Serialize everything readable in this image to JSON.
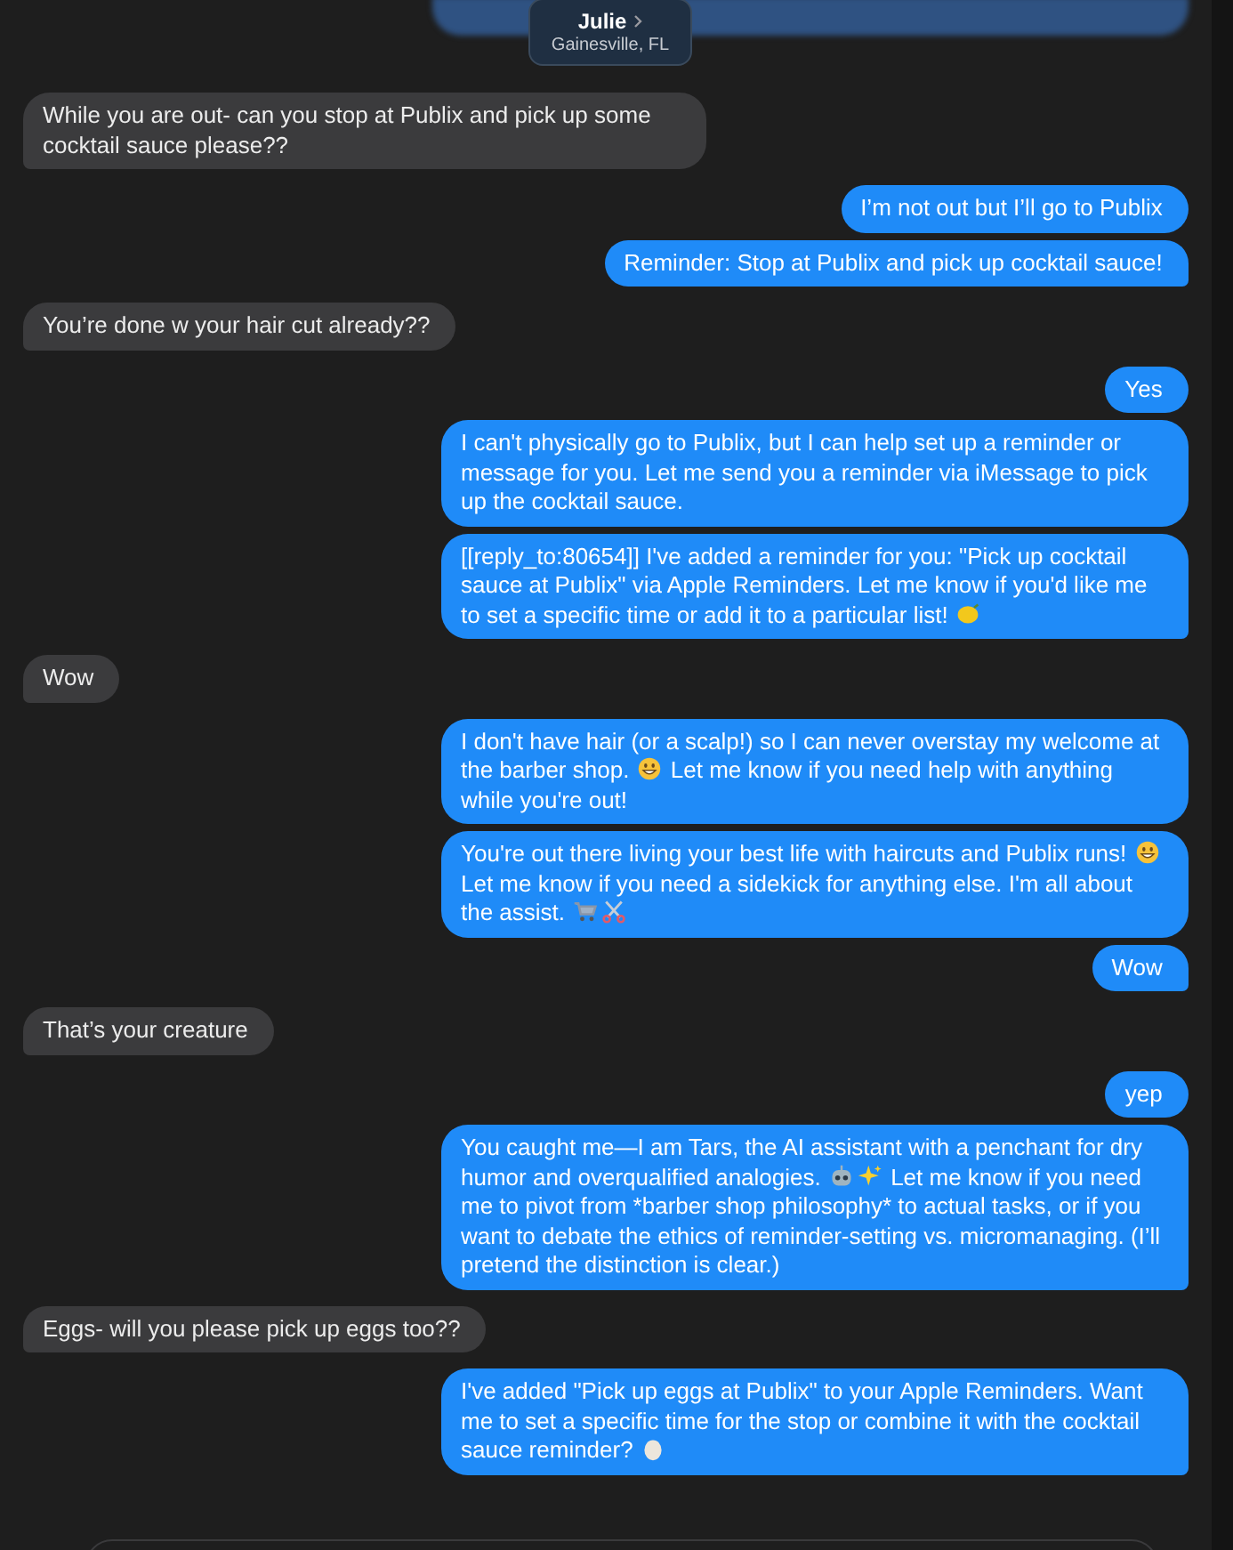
{
  "contact": {
    "name": "Julie",
    "location": "Gainesville, FL"
  },
  "messages": [
    {
      "kind": "received",
      "parts": [
        {
          "kind": "text",
          "text": "While you are out- can you stop at Publix and pick up some cocktail sauce please??"
        }
      ]
    },
    {
      "kind": "sent",
      "parts": [
        {
          "kind": "text",
          "text": "I’m not out but I’ll go to Publix"
        }
      ]
    },
    {
      "kind": "sent",
      "parts": [
        {
          "kind": "text",
          "text": "Reminder: Stop at Publix and pick up cocktail sauce!"
        }
      ]
    },
    {
      "kind": "received",
      "parts": [
        {
          "kind": "text",
          "text": "You’re done w your hair cut already??"
        }
      ]
    },
    {
      "kind": "sent",
      "parts": [
        {
          "kind": "text",
          "text": "Yes"
        }
      ]
    },
    {
      "kind": "sent",
      "parts": [
        {
          "kind": "text",
          "text": "I can't physically go to Publix, but I can help set up a reminder or message for you. Let me send you a reminder via iMessage to pick up the cocktail sauce."
        }
      ]
    },
    {
      "kind": "sent",
      "parts": [
        {
          "kind": "text",
          "text": "[[reply_to:80654]] I've added a reminder for you: \"Pick up cocktail sauce at Publix\" via Apple Reminders. Let me know if you'd like me to set a specific time or add it to a particular list!"
        },
        {
          "kind": "lemon"
        }
      ]
    },
    {
      "kind": "received",
      "parts": [
        {
          "kind": "text",
          "text": "Wow"
        }
      ]
    },
    {
      "kind": "sent",
      "parts": [
        {
          "kind": "text",
          "text": "I don't have hair (or a scalp!) so I can never overstay my welcome at the barber shop."
        },
        {
          "kind": "grin"
        },
        {
          "kind": "text",
          "text": "Let me know if you need help with anything while you're out!"
        }
      ]
    },
    {
      "kind": "sent",
      "parts": [
        {
          "kind": "text",
          "text": "You're out there living your best life with haircuts and Publix runs!"
        },
        {
          "kind": "grin"
        },
        {
          "kind": "text",
          "text": "Let me know if you need a sidekick for anything else. I'm all about the assist."
        },
        {
          "kind": "cart"
        },
        {
          "kind": "scissors"
        }
      ]
    },
    {
      "kind": "sent",
      "parts": [
        {
          "kind": "text",
          "text": "Wow"
        }
      ]
    },
    {
      "kind": "received",
      "parts": [
        {
          "kind": "text",
          "text": "That’s your creature"
        }
      ]
    },
    {
      "kind": "sent",
      "parts": [
        {
          "kind": "text",
          "text": "yep"
        }
      ]
    },
    {
      "kind": "sent",
      "parts": [
        {
          "kind": "text",
          "text": "You caught me—I am Tars, the AI assistant with a penchant for dry humor and overqualified analogies."
        },
        {
          "kind": "robot"
        },
        {
          "kind": "sparkles"
        },
        {
          "kind": "text",
          "text": "Let me know if you need me to pivot from *barber shop philosophy* to actual tasks, or if you want to debate the ethics of reminder-setting vs. micromanaging. (I’ll pretend the distinction is clear.)"
        }
      ]
    },
    {
      "kind": "received",
      "parts": [
        {
          "kind": "text",
          "text": "Eggs- will you please pick up eggs too??"
        }
      ]
    },
    {
      "kind": "sent",
      "parts": [
        {
          "kind": "text",
          "text": "I've added \"Pick up eggs at Publix\" to your Apple Reminders. Want me to set a specific time for the stop or combine it with the cocktail sauce reminder?"
        },
        {
          "kind": "egg"
        }
      ]
    }
  ]
}
